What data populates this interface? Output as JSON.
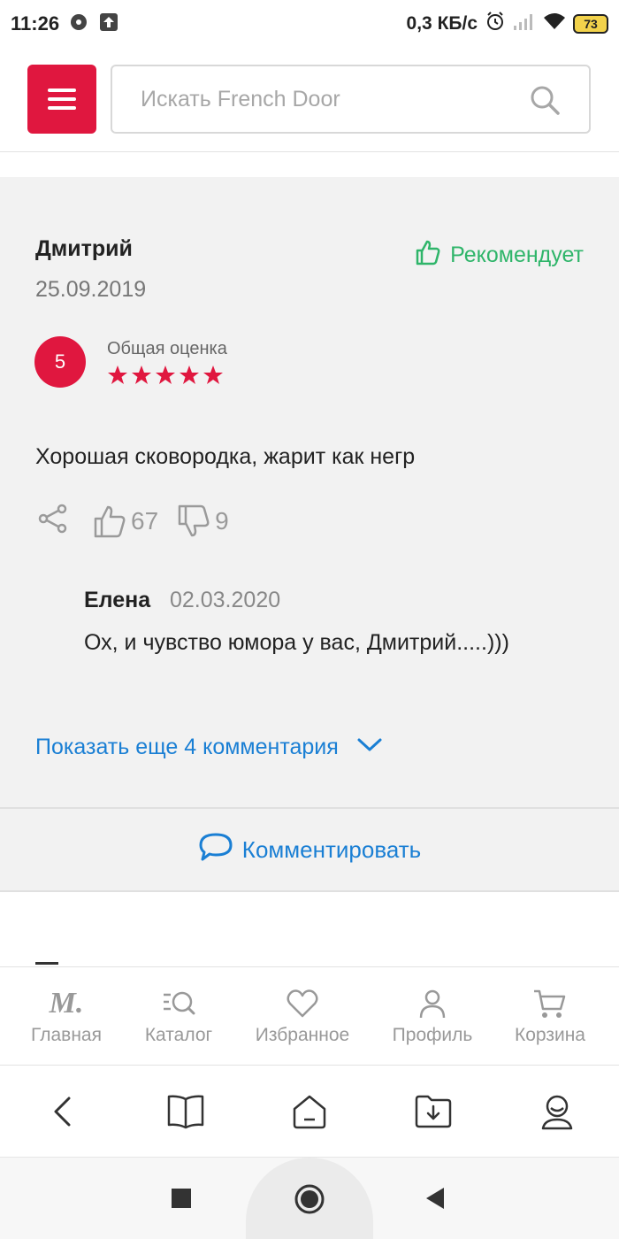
{
  "status_bar": {
    "time": "11:26",
    "speed": "0,3 КБ/с",
    "battery": "73"
  },
  "header": {
    "search_placeholder": "Искать French Door"
  },
  "review": {
    "author": "Дмитрий",
    "date": "25.09.2019",
    "recommend_label": "Рекомендует",
    "score": "5",
    "rating_label": "Общая оценка",
    "stars": 5,
    "text": "Хорошая сковородка, жарит как негр",
    "likes": "67",
    "dislikes": "9"
  },
  "reply": {
    "author": "Елена",
    "date": "02.03.2020",
    "text": "Ох, и чувство юмора у вас, Дмитрий.....)))"
  },
  "show_more_label": "Показать еще 4 комментария",
  "comment_button_label": "Комментировать",
  "bottom_nav": {
    "items": [
      {
        "label": "Главная",
        "icon": "logo-m-icon"
      },
      {
        "label": "Каталог",
        "icon": "catalog-icon"
      },
      {
        "label": "Избранное",
        "icon": "heart-icon"
      },
      {
        "label": "Профиль",
        "icon": "user-icon"
      },
      {
        "label": "Корзина",
        "icon": "cart-icon"
      }
    ],
    "logo_text": "M."
  },
  "colors": {
    "brand_red": "#e0173f",
    "recommend_green": "#2fb56a",
    "link_blue": "#1a7fd4"
  }
}
